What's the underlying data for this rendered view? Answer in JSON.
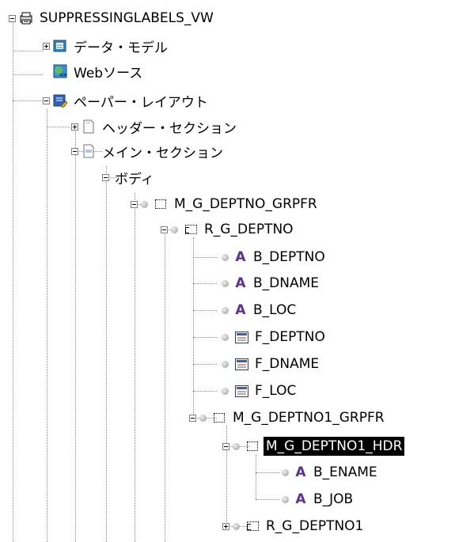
{
  "tree": {
    "root": {
      "label": "SUPPRESSINGLABELS_VW",
      "icon": "report-icon"
    },
    "data_model": {
      "label": "データ・モデル",
      "icon": "data-model-icon"
    },
    "web_source": {
      "label": "Webソース",
      "icon": "web-source-icon"
    },
    "paper_layout": {
      "label": "ペーパー・レイアウト",
      "icon": "paper-layout-icon"
    },
    "header_section": {
      "label": "ヘッダー・セクション",
      "icon": "page-icon"
    },
    "main_section": {
      "label": "メイン・セクション",
      "icon": "page-icon"
    },
    "body": {
      "label": "ボディ"
    },
    "m_g_deptno_grpfr": {
      "label": "M_G_DEPTNO_GRPFR",
      "icon": "frame-icon"
    },
    "r_g_deptno": {
      "label": "R_G_DEPTNO",
      "icon": "repeating-frame-icon"
    },
    "b_deptno": {
      "label": "B_DEPTNO",
      "icon": "text-icon"
    },
    "b_dname": {
      "label": "B_DNAME",
      "icon": "text-icon"
    },
    "b_loc": {
      "label": "B_LOC",
      "icon": "text-icon"
    },
    "f_deptno": {
      "label": "F_DEPTNO",
      "icon": "field-icon"
    },
    "f_dname": {
      "label": "F_DNAME",
      "icon": "field-icon"
    },
    "f_loc": {
      "label": "F_LOC",
      "icon": "field-icon"
    },
    "m_g_deptno1_grpfr": {
      "label": "M_G_DEPTNO1_GRPFR",
      "icon": "frame-icon"
    },
    "m_g_deptno1_hdr": {
      "label": "M_G_DEPTNO1_HDR",
      "icon": "frame-icon",
      "selected": true
    },
    "b_ename": {
      "label": "B_ENAME",
      "icon": "text-icon"
    },
    "b_job": {
      "label": "B_JOB",
      "icon": "text-icon"
    },
    "r_g_deptno1": {
      "label": "R_G_DEPTNO1",
      "icon": "repeating-frame-icon"
    }
  },
  "colors": {
    "selection_bg": "#000000",
    "selection_fg": "#ffffff",
    "text_icon": "#5b2f9c",
    "tree_lines": "#8a8a8a"
  }
}
